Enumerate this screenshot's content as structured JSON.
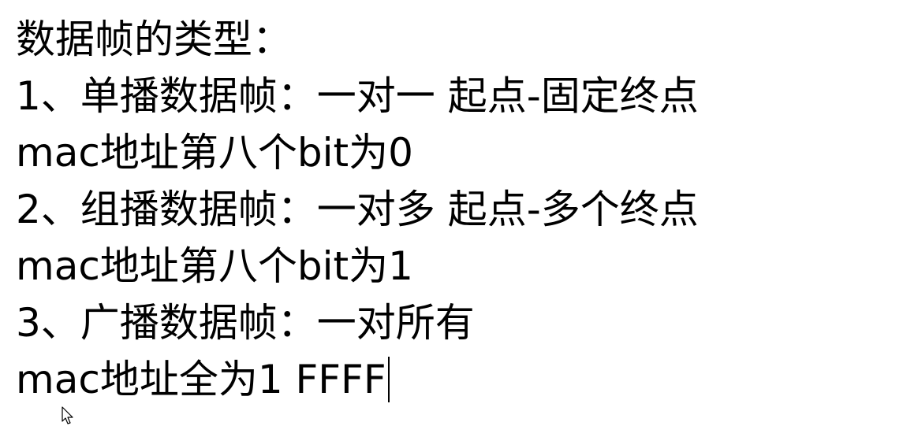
{
  "lines": [
    "数据帧的类型：",
    "1、单播数据帧：一对一 起点-固定终点",
    "mac地址第八个bit为0",
    "2、组播数据帧：一对多 起点-多个终点",
    "mac地址第八个bit为1",
    "3、广播数据帧：一对所有",
    "mac地址全为1 FFFF"
  ]
}
